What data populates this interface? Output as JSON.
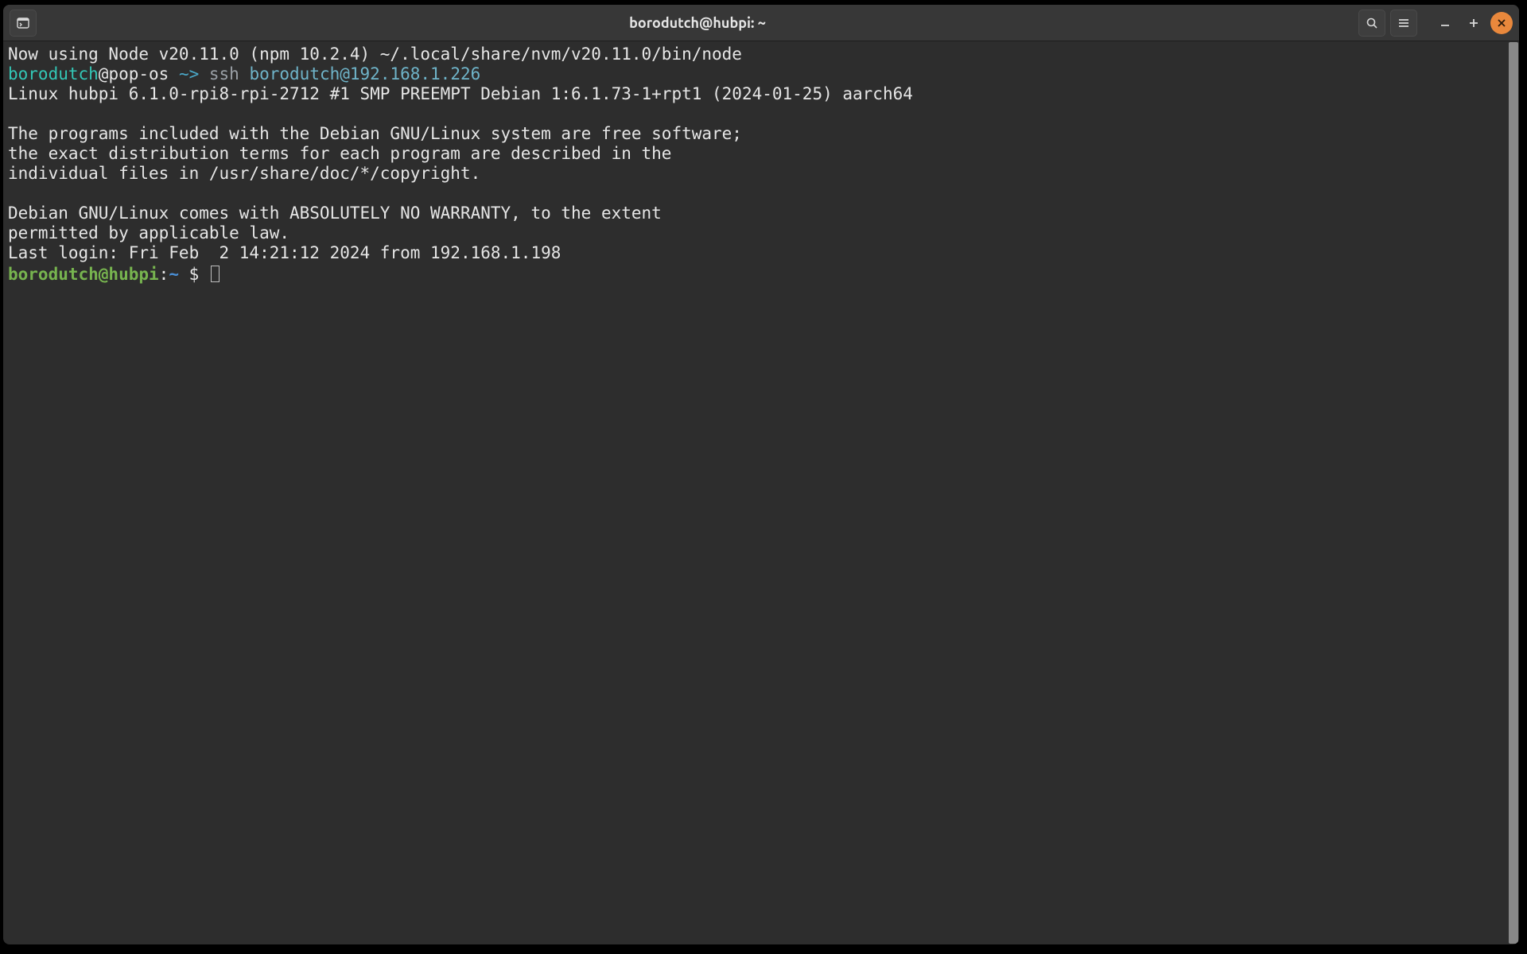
{
  "titlebar": {
    "title": "borodutch@hubpi: ~"
  },
  "local_prompt": {
    "user": "borodutch",
    "at_host": "@pop-os",
    "path": " ~> ",
    "cmd": "ssh ",
    "arg": "borodutch@192.168.1.226"
  },
  "output": {
    "nvm": "Now using Node v20.11.0 (npm 10.2.4) ~/.local/share/nvm/v20.11.0/bin/node",
    "uname": "Linux hubpi 6.1.0-rpi8-rpi-2712 #1 SMP PREEMPT Debian 1:6.1.73-1+rpt1 (2024-01-25) aarch64",
    "blank1": "",
    "motd1": "The programs included with the Debian GNU/Linux system are free software;",
    "motd2": "the exact distribution terms for each program are described in the",
    "motd3": "individual files in /usr/share/doc/*/copyright.",
    "blank2": "",
    "motd4": "Debian GNU/Linux comes with ABSOLUTELY NO WARRANTY, to the extent",
    "motd5": "permitted by applicable law.",
    "last": "Last login: Fri Feb  2 14:21:12 2024 from 192.168.1.198"
  },
  "remote_prompt": {
    "userhost": "borodutch@hubpi",
    "colon": ":",
    "path": "~",
    "sep": " ",
    "dollar": "$"
  }
}
